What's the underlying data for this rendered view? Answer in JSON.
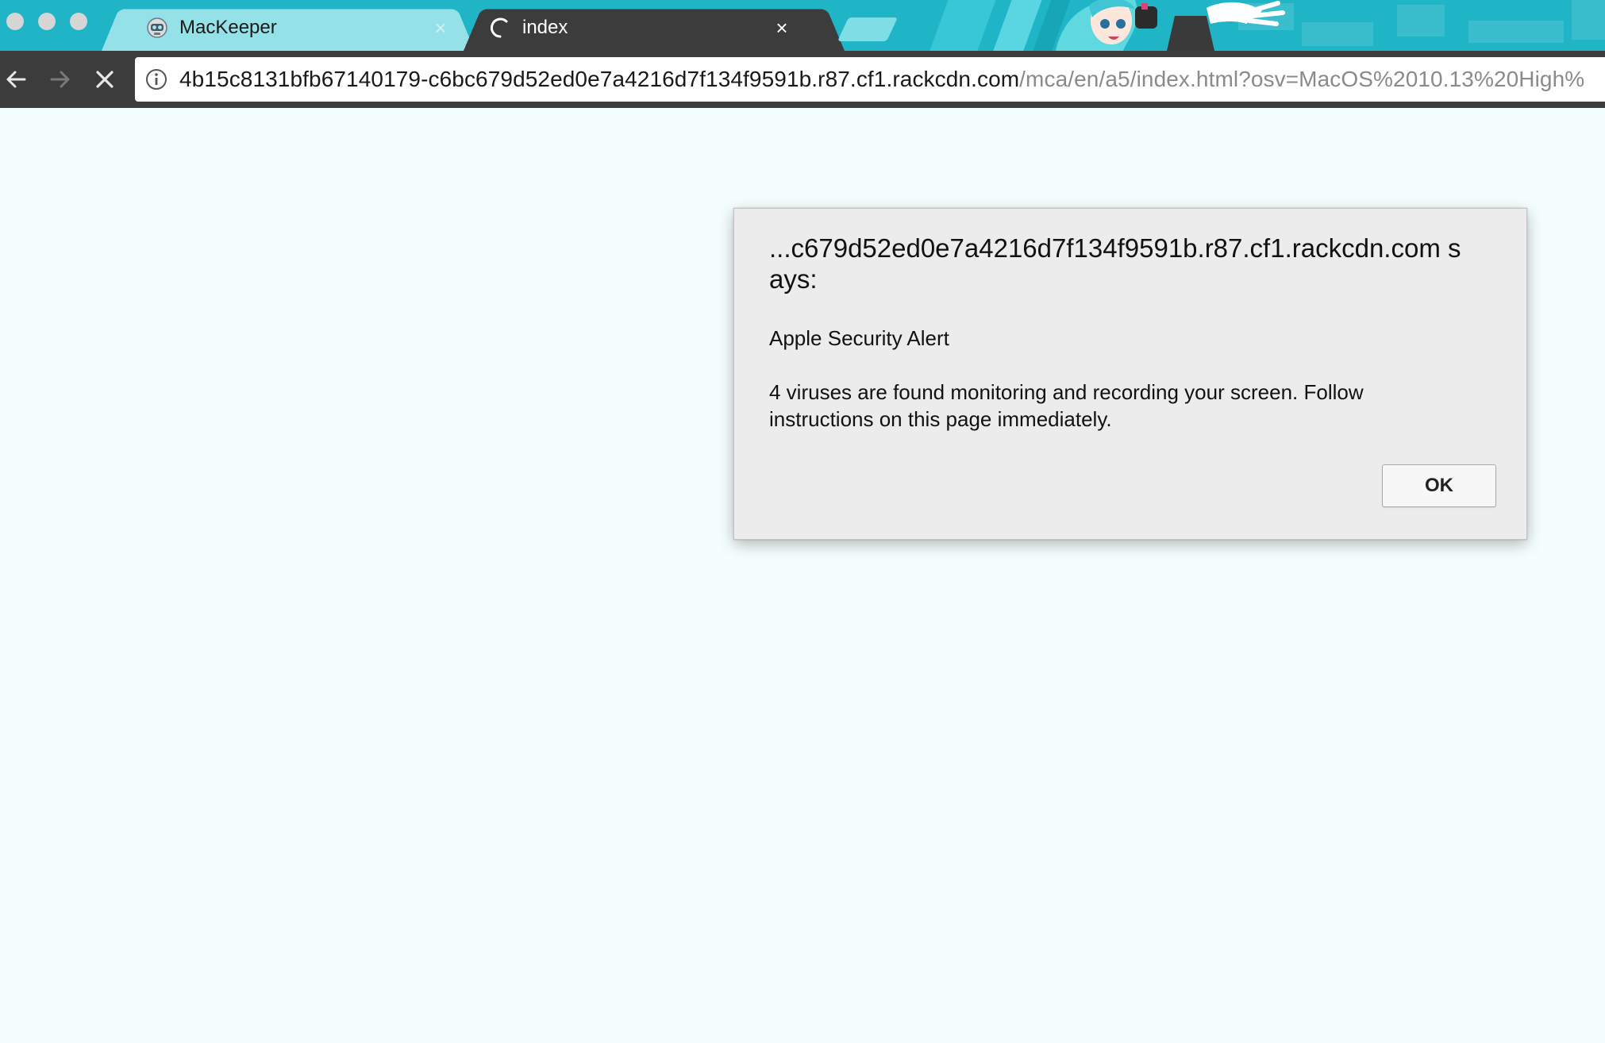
{
  "browser": {
    "tabs": [
      {
        "title": "MacKeeper",
        "active": false,
        "favicon": "mackeeper-robot-icon"
      },
      {
        "title": "index",
        "active": true,
        "favicon": "loading-spinner-icon"
      }
    ],
    "close_glyph": "×",
    "toolbar": {
      "back_icon": "back-arrow-icon",
      "forward_icon": "forward-arrow-icon",
      "stop_icon": "stop-loading-icon"
    },
    "address_bar": {
      "security_icon": "info-icon",
      "url_host": "4b15c8131bfb67140179-c6bc679d52ed0e7a4216d7f134f9591b.r87.cf1.rackcdn.com",
      "url_path": "/mca/en/a5/index.html?osv=MacOS%2010.13%20High%"
    },
    "theme_colors": {
      "tabstrip": "#1fb5c7",
      "toolbar": "#3c3c3c",
      "inactive_tab": "#95e1e8",
      "page_background": "#f5fefe"
    }
  },
  "dialog": {
    "origin_line": "...c679d52ed0e7a4216d7f134f9591b.r87.cf1.rackcdn.com says:",
    "heading": "Apple Security Alert",
    "message": "4 viruses are found monitoring and recording your screen. Follow instructions on this page immediately.",
    "ok_label": "OK"
  }
}
